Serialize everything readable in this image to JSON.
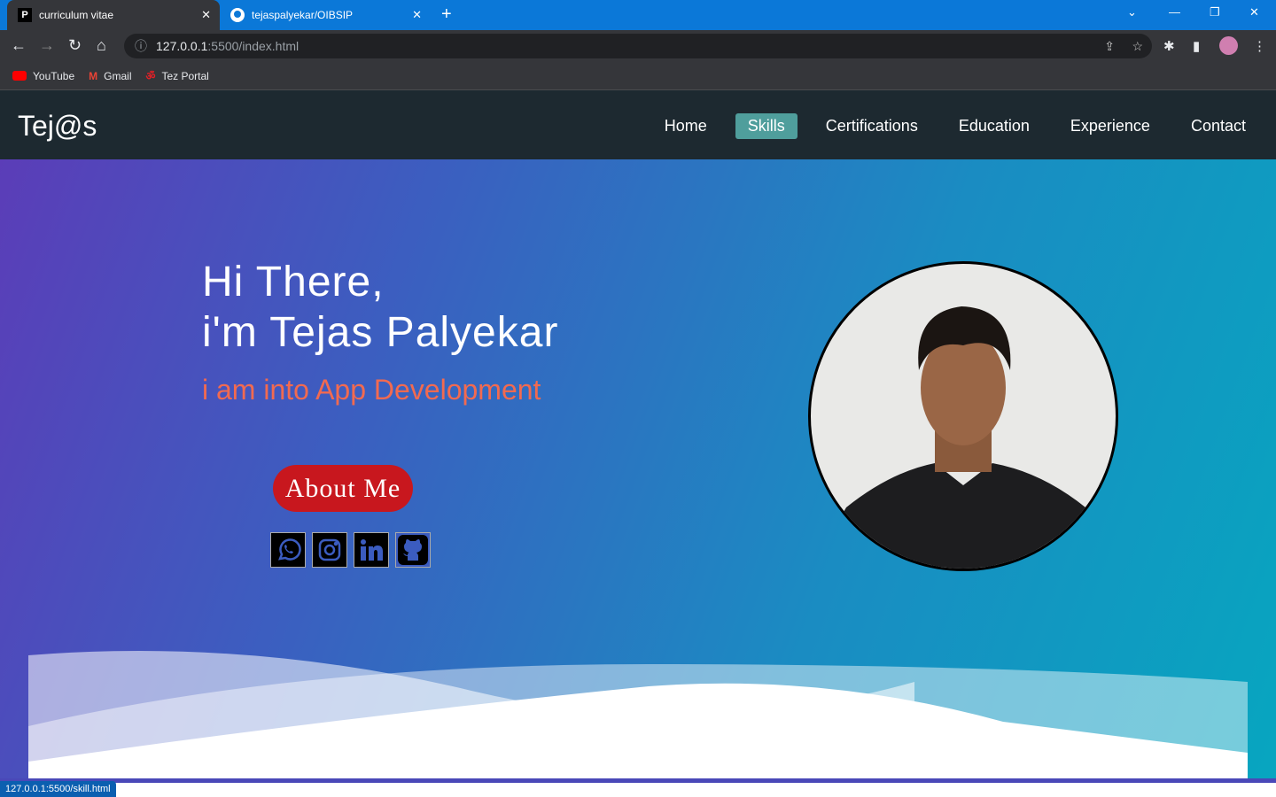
{
  "browser": {
    "tabs": [
      {
        "label": "curriculum vitae",
        "icon": "P"
      },
      {
        "label": "tejaspalyekar/OIBSIP",
        "icon": "github"
      }
    ],
    "url_host": "127.0.0.1",
    "url_rest": ":5500/index.html",
    "bookmarks": [
      "YouTube",
      "Gmail",
      "Tez Portal"
    ],
    "status_url": "127.0.0.1:5500/skill.html"
  },
  "site": {
    "logo": "Tej@s",
    "menu": [
      "Home",
      "Skills",
      "Certifications",
      "Education",
      "Experience",
      "Contact"
    ],
    "active": "Skills",
    "greeting_line1": "Hi There,",
    "greeting_line2": "i'm Tejas Palyekar",
    "tagline": "i am into App Development",
    "about_button": "About Me",
    "socials": [
      "whatsapp",
      "instagram",
      "linkedin",
      "github"
    ]
  }
}
